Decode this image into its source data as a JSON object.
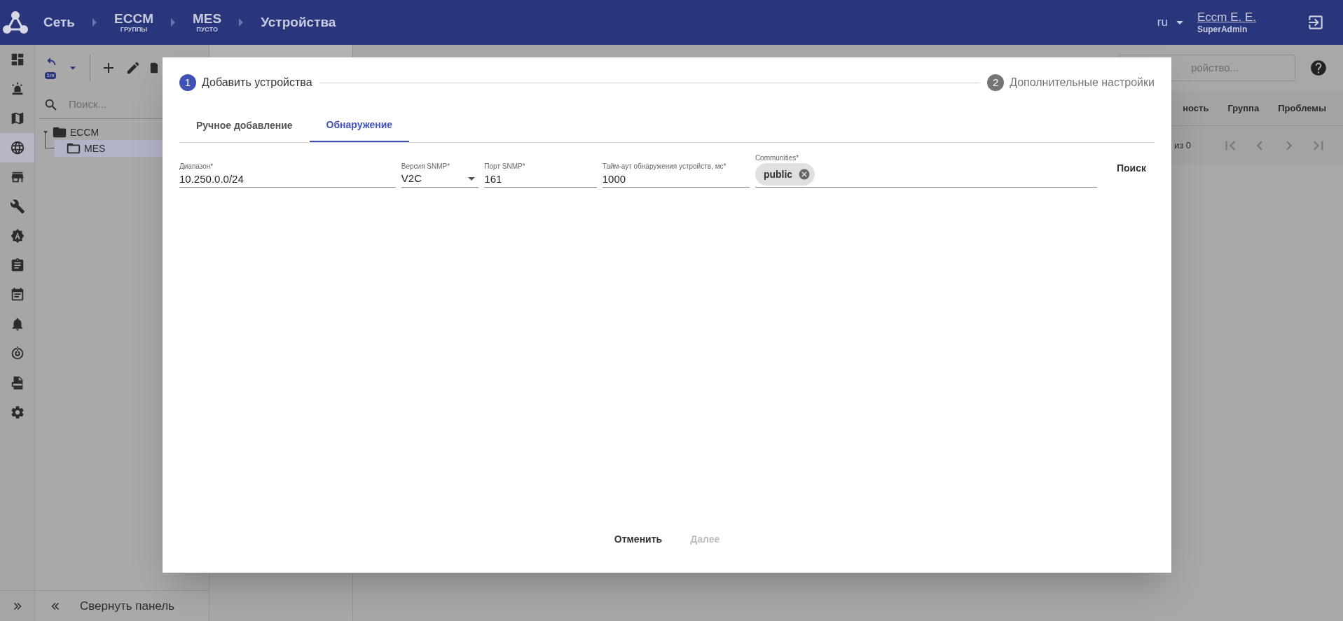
{
  "header": {
    "breadcrumbs": [
      {
        "label": "Сеть"
      },
      {
        "label": "ECCM",
        "sublabel": "ГРУППЫ"
      },
      {
        "label": "MES",
        "sublabel": "ПУСТО"
      },
      {
        "label": "Устройства"
      }
    ],
    "language": "ru",
    "user": {
      "name": "Eccm E. E.",
      "role": "SuperAdmin"
    }
  },
  "nav_rail": {
    "items": [
      {
        "kind": "dashboard",
        "selected": false
      },
      {
        "kind": "siren",
        "selected": false
      },
      {
        "kind": "map",
        "selected": false
      },
      {
        "kind": "globe",
        "selected": true
      },
      {
        "kind": "store",
        "selected": false
      },
      {
        "kind": "wrench",
        "selected": false
      },
      {
        "kind": "badge",
        "selected": false
      },
      {
        "kind": "clipboard",
        "selected": false
      },
      {
        "kind": "calendar",
        "selected": false
      },
      {
        "kind": "bell",
        "selected": false
      },
      {
        "kind": "radar",
        "selected": false
      },
      {
        "kind": "log",
        "selected": false
      },
      {
        "kind": "gear",
        "selected": false
      }
    ]
  },
  "tree_panel": {
    "undo_badge": "1m",
    "search_placeholder": "Поиск...",
    "tree": [
      {
        "label": "ECCM",
        "expanded": true,
        "selected": false,
        "children": [
          {
            "label": "MES",
            "selected": true
          }
        ]
      }
    ],
    "collapse_label": "Свернуть панель"
  },
  "devices_view": {
    "search_placeholder": "ройство...",
    "columns": [
      "ность",
      "Группа",
      "Проблемы"
    ],
    "pagination": "из 0"
  },
  "dialog": {
    "steps": [
      {
        "number": "1",
        "label": "Добавить устройства",
        "selected": true
      },
      {
        "number": "2",
        "label": "Дополнительные настройки",
        "selected": false
      }
    ],
    "tabs": [
      {
        "label": "Ручное добавление",
        "selected": false
      },
      {
        "label": "Обнаружение",
        "selected": true
      }
    ],
    "fields": [
      {
        "kind": "text",
        "label": "Диапазон*",
        "value": "10.250.0.0/24"
      },
      {
        "kind": "select",
        "label": "Версия SNMP*",
        "value": "V2C"
      },
      {
        "kind": "text",
        "label": "Порт SNMP*",
        "value": "161"
      },
      {
        "kind": "text",
        "label": "Тайм-аут обнаружения устройств, мс*",
        "value": "1000"
      },
      {
        "kind": "chips",
        "label": "Communities*",
        "chips": [
          "public"
        ]
      }
    ],
    "search_button": "Поиск",
    "actions": [
      {
        "label": "Отменить",
        "disabled": false
      },
      {
        "label": "Далее",
        "disabled": true
      }
    ]
  }
}
